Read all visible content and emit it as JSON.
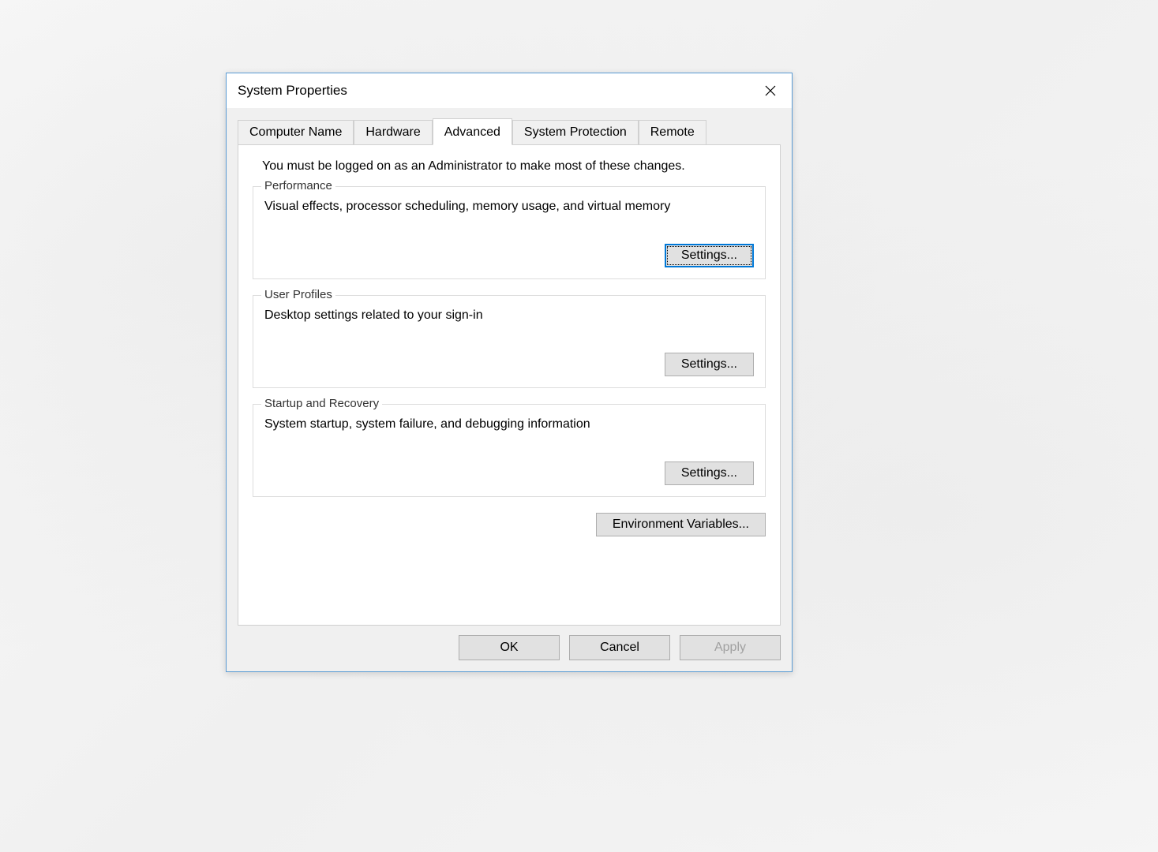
{
  "dialog": {
    "title": "System Properties",
    "tabs": [
      {
        "label": "Computer Name"
      },
      {
        "label": "Hardware"
      },
      {
        "label": "Advanced"
      },
      {
        "label": "System Protection"
      },
      {
        "label": "Remote"
      }
    ],
    "active_tab_index": 2,
    "admin_note": "You must be logged on as an Administrator to make most of these changes.",
    "groups": {
      "performance": {
        "legend": "Performance",
        "desc": "Visual effects, processor scheduling, memory usage, and virtual memory",
        "button": "Settings..."
      },
      "user_profiles": {
        "legend": "User Profiles",
        "desc": "Desktop settings related to your sign-in",
        "button": "Settings..."
      },
      "startup": {
        "legend": "Startup and Recovery",
        "desc": "System startup, system failure, and debugging information",
        "button": "Settings..."
      }
    },
    "env_button": "Environment Variables...",
    "buttons": {
      "ok": "OK",
      "cancel": "Cancel",
      "apply": "Apply"
    }
  }
}
